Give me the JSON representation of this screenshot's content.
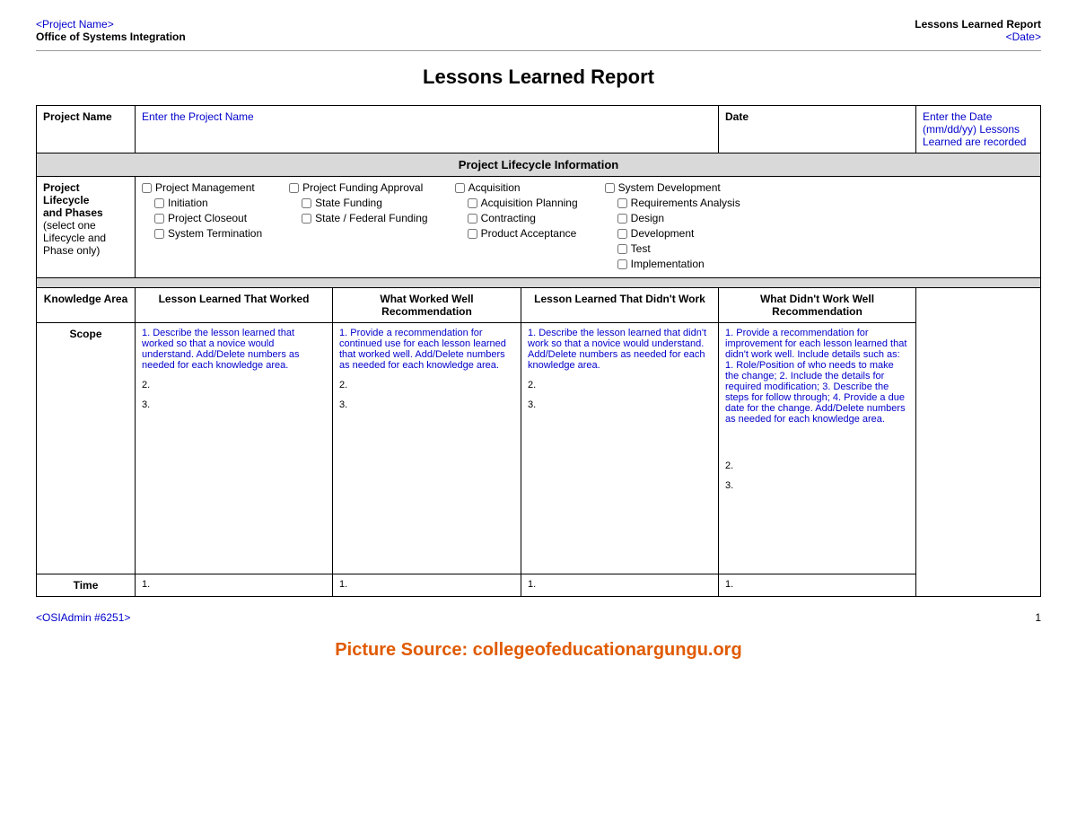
{
  "header": {
    "project_name_link": "<Project Name>",
    "org_name": "Office of Systems Integration",
    "report_title": "Lessons Learned Report",
    "date_link": "<Date>"
  },
  "main_title": "Lessons Learned Report",
  "project_row": {
    "name_label": "Project Name",
    "name_placeholder": "Enter the Project Name",
    "date_label": "Date",
    "date_placeholder": "Enter the Date (mm/dd/yy) Lessons Learned are recorded"
  },
  "lifecycle": {
    "section_header": "Project Lifecycle Information",
    "label_line1": "Project",
    "label_line2": "Lifecycle",
    "label_line3": "and Phases",
    "label_sub": "(select one Lifecycle and Phase only)",
    "column1": [
      "Project Management",
      "Initiation",
      "Project Closeout",
      "System Termination"
    ],
    "column2": [
      "Project Funding Approval",
      "State Funding",
      "State / Federal Funding"
    ],
    "column3": [
      "Acquisition",
      "Acquisition Planning",
      "Contracting",
      "Product Acceptance"
    ],
    "column4": [
      "System Development",
      "Requirements Analysis",
      "Design",
      "Development",
      "Test",
      "Implementation"
    ]
  },
  "table": {
    "col_headers": [
      "Knowledge Area",
      "Lesson Learned That Worked",
      "What Worked Well Recommendation",
      "Lesson Learned That Didn't Work",
      "What Didn't Work Well Recommendation"
    ],
    "rows": [
      {
        "area": "Scope",
        "worked_items": [
          "Describe the lesson learned that worked so that a novice would understand. Add/Delete numbers as needed for each knowledge area.",
          "2.",
          "3."
        ],
        "worked_rec_items": [
          "Provide a recommendation for continued use for each lesson learned that worked well. Add/Delete numbers as needed for each knowledge area.",
          "2.",
          "3."
        ],
        "didnt_work_items": [
          "Describe the lesson learned that didn't work so that a novice would understand. Add/Delete numbers as needed for each knowledge area.",
          "2.",
          "3."
        ],
        "didnt_work_rec_items": [
          "Provide a recommendation for improvement for each lesson learned that didn't work well. Include details such as: 1. Role/Position of who needs to make the change; 2. Include the details for required modification; 3. Describe the steps for follow through; 4. Provide a due date for the change. Add/Delete numbers as needed for each knowledge area.",
          "2.",
          "3."
        ]
      },
      {
        "area": "Time",
        "worked_items": [
          "1."
        ],
        "worked_rec_items": [
          "1."
        ],
        "didnt_work_items": [
          "1."
        ],
        "didnt_work_rec_items": [
          "1."
        ]
      }
    ]
  },
  "footer": {
    "admin_link": "<OSIAdmin #6251>",
    "page_number": "1"
  },
  "picture_source": "Picture Source: collegeofeducationargungu.org"
}
